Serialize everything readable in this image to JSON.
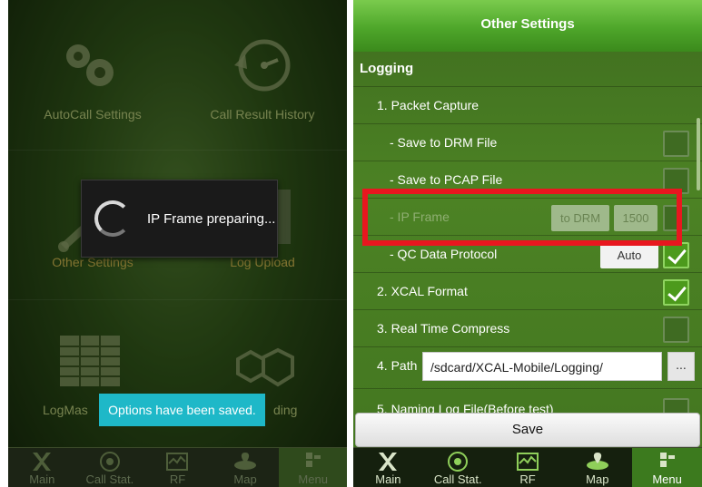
{
  "left": {
    "tiles": [
      {
        "label": "AutoCall Settings",
        "icon": "gears-icon"
      },
      {
        "label": "Call Result History",
        "icon": "history-icon"
      },
      {
        "label": "Other Settings",
        "icon": "wrench-icon"
      },
      {
        "label": "Log Upload",
        "icon": "upload-icon"
      },
      {
        "label": "LogMas",
        "icon": "table-icon"
      },
      {
        "label": "ding",
        "icon": "cubes-icon"
      }
    ],
    "dialog": {
      "text": "IP Frame preparing..."
    },
    "toast": {
      "text": "Options have been saved."
    },
    "nav": [
      {
        "label": "Main",
        "icon": "xcal-icon"
      },
      {
        "label": "Call Stat.",
        "icon": "call-stat-icon"
      },
      {
        "label": "RF",
        "icon": "rf-icon"
      },
      {
        "label": "Map",
        "icon": "map-icon"
      },
      {
        "label": "Menu",
        "icon": "menu-icon"
      }
    ]
  },
  "right": {
    "title": "Other Settings",
    "section": "Logging",
    "rows": {
      "packet_capture": "1. Packet Capture",
      "save_drm": "- Save to DRM File",
      "save_pcap": "- Save to PCAP File",
      "ip_frame": "- IP Frame",
      "ip_frame_target": "to DRM",
      "ip_frame_size": "1500",
      "qc_protocol": "- QC Data Protocol",
      "qc_protocol_value": "Auto",
      "xcal_format": "2. XCAL Format",
      "realtime_compress": "3. Real Time Compress",
      "path_label": "4. Path",
      "path_value": "/sdcard/XCAL-Mobile/Logging/",
      "path_button": "...",
      "naming": "5. Naming Log File(Before test)"
    },
    "checks": {
      "save_drm": false,
      "save_pcap": false,
      "ip_frame": false,
      "qc_protocol": true,
      "xcal_format": true,
      "realtime_compress": false
    },
    "save_label": "Save",
    "nav": [
      {
        "label": "Main",
        "icon": "xcal-icon"
      },
      {
        "label": "Call Stat.",
        "icon": "call-stat-icon"
      },
      {
        "label": "RF",
        "icon": "rf-icon"
      },
      {
        "label": "Map",
        "icon": "map-icon"
      },
      {
        "label": "Menu",
        "icon": "menu-icon"
      }
    ],
    "active_nav": "Menu"
  },
  "colors": {
    "highlight": "#e8171f",
    "toast": "#1eb8c8",
    "header": "#4ea62a"
  }
}
